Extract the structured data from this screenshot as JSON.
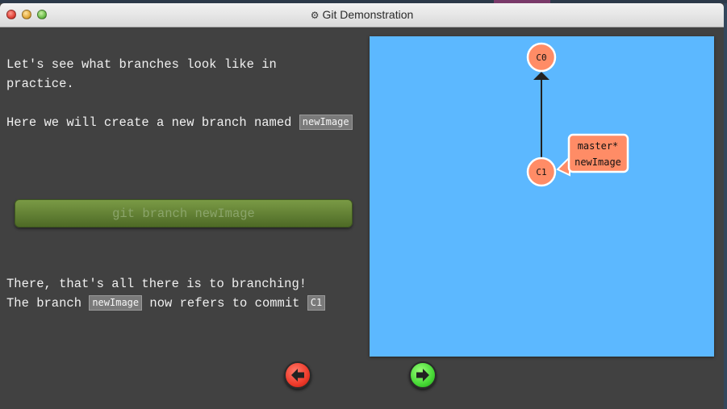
{
  "window": {
    "title": "Git Demonstration",
    "title_icon": "gear-icon"
  },
  "lesson": {
    "para1": "Let's see what branches look like in practice.",
    "para2_text": "Here we will create a new branch named ",
    "para2_tag": "newImage",
    "para3_line1": "There, that's all there is to branching!",
    "para3_pre": "The branch ",
    "para3_tag": "newImage",
    "para3_mid": " now refers to commit ",
    "para3_commit": "C1"
  },
  "command": {
    "label": "git branch newImage"
  },
  "graph": {
    "commits": [
      {
        "id": "C0"
      },
      {
        "id": "C1"
      }
    ],
    "branch_labels": [
      "master*",
      "newImage"
    ]
  },
  "nav": {
    "back_icon": "arrow-left-icon",
    "forward_icon": "arrow-right-icon"
  },
  "colors": {
    "canvas": "#5cb8ff",
    "commit": "#ff8c66",
    "button": "#5a7a30"
  }
}
